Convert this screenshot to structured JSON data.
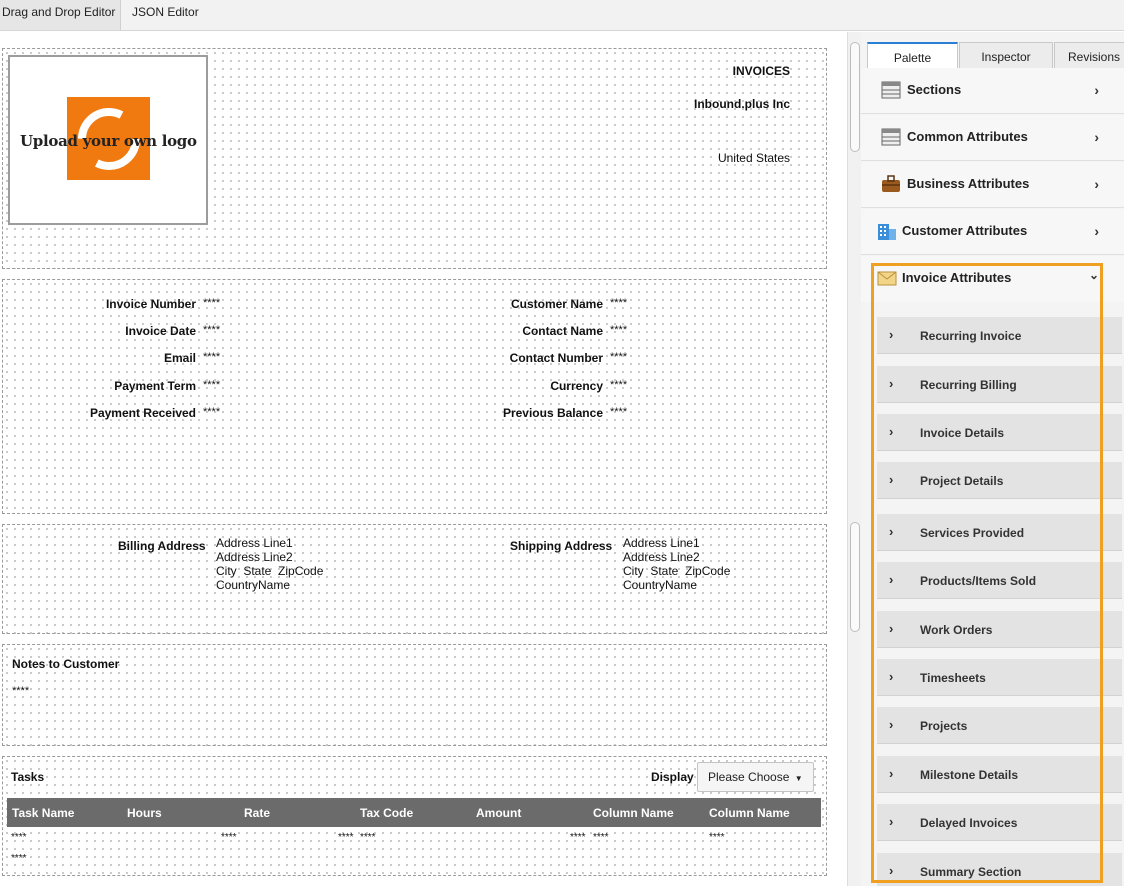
{
  "top_tabs": [
    "Drag and Drop Editor",
    "JSON Editor"
  ],
  "header": {
    "logo_text": "Upload your own logo",
    "title": "INVOICES",
    "company": "Inbound.plus Inc",
    "country": "United States"
  },
  "info": {
    "left": [
      {
        "label": "Invoice Number",
        "value": "****"
      },
      {
        "label": "Invoice Date",
        "value": "****"
      },
      {
        "label": "Email",
        "value": "****"
      },
      {
        "label": "Payment Term",
        "value": "****"
      },
      {
        "label": "Payment Received",
        "value": "****"
      }
    ],
    "right": [
      {
        "label": "Customer Name",
        "value": "****"
      },
      {
        "label": "Contact Name",
        "value": "****"
      },
      {
        "label": "Contact Number",
        "value": "****"
      },
      {
        "label": "Currency",
        "value": "****"
      },
      {
        "label": "Previous Balance",
        "value": "****"
      }
    ]
  },
  "address": {
    "billing_label": "Billing Address",
    "billing_lines": [
      "Address Line1",
      "Address Line2",
      "City  State  ZipCode",
      "CountryName"
    ],
    "shipping_label": "Shipping Address",
    "shipping_lines": [
      "Address Line1",
      "Address Line2",
      "City  State  ZipCode",
      "CountryName"
    ]
  },
  "notes": {
    "title": "Notes to Customer",
    "value": "****"
  },
  "tasks": {
    "title": "Tasks",
    "display_label": "Display",
    "select_value": "Please Choose",
    "columns": [
      "Task Name",
      "Hours",
      "Rate",
      "Tax Code",
      "Amount",
      "Column Name",
      "Column Name"
    ],
    "row1": [
      "****",
      "****",
      "****",
      "****",
      "****",
      "****",
      "****"
    ],
    "row2": [
      "****"
    ]
  },
  "panel": {
    "tabs": [
      "Palette",
      "Inspector",
      "Revisions"
    ],
    "items": [
      {
        "label": "Sections",
        "icon": "table-icon"
      },
      {
        "label": "Common Attributes",
        "icon": "table-icon"
      },
      {
        "label": "Business Attributes",
        "icon": "briefcase-icon"
      },
      {
        "label": "Customer Attributes",
        "icon": "building-icon"
      },
      {
        "label": "Invoice Attributes",
        "icon": "envelope-icon"
      }
    ],
    "sub_items": [
      "Recurring Invoice",
      "Recurring Billing",
      "Invoice Details",
      "Project Details",
      "Services Provided",
      "Products/Items Sold",
      "Work Orders",
      "Timesheets",
      "Projects",
      "Milestone Details",
      "Delayed Invoices",
      "Summary Section"
    ]
  },
  "colors": {
    "accent_orange": "#f0a020",
    "logo_orange": "#f07a10",
    "table_header": "#6b6b6b",
    "tab_accent": "#2a7fd4"
  }
}
